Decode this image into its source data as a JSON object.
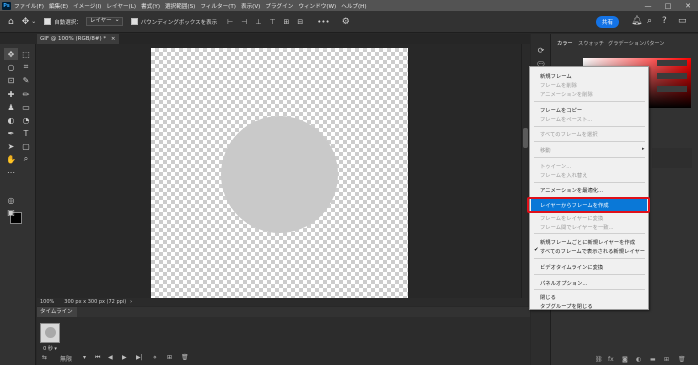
{
  "menubar": {
    "logo": "Ps",
    "items": [
      "ファイル(F)",
      "編集(E)",
      "イメージ(I)",
      "レイヤー(L)",
      "書式(Y)",
      "選択範囲(S)",
      "フィルター(T)",
      "表示(V)",
      "プラグイン",
      "ウィンドウ(W)",
      "ヘルプ(H)"
    ],
    "window_controls": [
      "—",
      "□",
      "✕"
    ]
  },
  "options_bar": {
    "home_icon": "home-icon",
    "auto_select_label": "自動選択：",
    "auto_select_value": "レイヤー",
    "bounding_box_label": "バウンディングボックスを表示",
    "more": "•••",
    "share_label": "共有"
  },
  "document": {
    "tab_title": "GIF @ 100% (RGB/8#) *",
    "tab_close": "×",
    "zoom": "100%",
    "size_info": "300 px x 300 px (72 ppi)"
  },
  "timeline": {
    "tab_label": "タイムライン",
    "frame_delay": "0 秒 ▾",
    "loop_label": "無限"
  },
  "right_panel": {
    "tabs": [
      "カラー",
      "スウォッチ",
      "グラデーション",
      "パターン"
    ],
    "colors": {
      "accent": "#1473e6",
      "highlight": "#0a78d7",
      "red_box": "#e0101a"
    }
  },
  "context_menu": {
    "items": [
      {
        "label": "新規フレーム",
        "enabled": true
      },
      {
        "label": "フレームを削除",
        "enabled": false
      },
      {
        "label": "アニメーションを削除",
        "enabled": false
      },
      {
        "label": "フレームをコピー",
        "enabled": true
      },
      {
        "label": "フレームをペースト...",
        "enabled": false
      },
      {
        "label": "すべてのフレームを選択",
        "enabled": false
      },
      {
        "label": "移動",
        "enabled": false,
        "submenu": true
      },
      {
        "label": "トゥイーン...",
        "enabled": false
      },
      {
        "label": "フレームを入れ替え",
        "enabled": false
      },
      {
        "label": "アニメーションを最適化...",
        "enabled": true
      },
      {
        "label": "レイヤーからフレームを作成",
        "enabled": true,
        "highlighted": true
      },
      {
        "label": "フレームをレイヤーに変換",
        "enabled": false
      },
      {
        "label": "フレーム間でレイヤーを一致...",
        "enabled": false
      },
      {
        "label": "新規フレームごとに新規レイヤーを作成",
        "enabled": true
      },
      {
        "label": "すべてのフレームで表示される新規レイヤー",
        "enabled": true,
        "checked": true
      },
      {
        "label": "ビデオタイムラインに変換",
        "enabled": true
      },
      {
        "label": "パネルオプション...",
        "enabled": true
      },
      {
        "label": "閉じる",
        "enabled": true
      },
      {
        "label": "タブグループを閉じる",
        "enabled": true
      }
    ]
  }
}
